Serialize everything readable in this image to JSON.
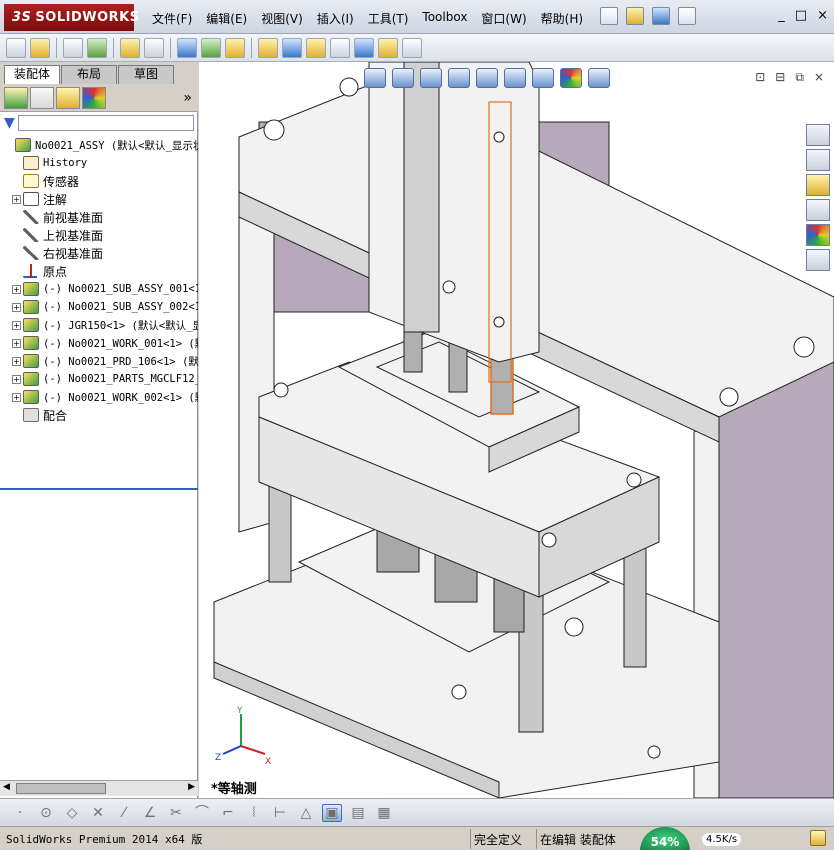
{
  "app": {
    "logo_text": "SOLIDWORKS",
    "logo_prefix": "3S"
  },
  "menu": [
    "文件(F)",
    "编辑(E)",
    "视图(V)",
    "插入(I)",
    "工具(T)",
    "Toolbox",
    "窗口(W)",
    "帮助(H)"
  ],
  "window_controls": [
    "_",
    "□",
    "×"
  ],
  "tabs": [
    {
      "label": "装配体",
      "active": true
    },
    {
      "label": "布局",
      "active": false
    },
    {
      "label": "草图",
      "active": false
    }
  ],
  "feature_manager_more": "»",
  "tree": [
    {
      "label": "No0021_ASSY  (默认<默认_显示状",
      "icon": "assembly-icon",
      "expand": "",
      "indent": 0,
      "mono": true
    },
    {
      "label": "History",
      "icon": "history-icon",
      "expand": "",
      "indent": 1,
      "mono": true
    },
    {
      "label": "传感器",
      "icon": "sensor-icon",
      "expand": "",
      "indent": 1,
      "mono": false
    },
    {
      "label": "注解",
      "icon": "annotation-icon",
      "expand": "+",
      "indent": 1,
      "mono": false
    },
    {
      "label": "前视基准面",
      "icon": "plane-icon",
      "expand": "",
      "indent": 1,
      "mono": false
    },
    {
      "label": "上视基准面",
      "icon": "plane-icon",
      "expand": "",
      "indent": 1,
      "mono": false
    },
    {
      "label": "右视基准面",
      "icon": "plane-icon",
      "expand": "",
      "indent": 1,
      "mono": false
    },
    {
      "label": "原点",
      "icon": "origin-icon",
      "expand": "",
      "indent": 1,
      "mono": false
    },
    {
      "label": "(-) No0021_SUB_ASSY_001<1>",
      "icon": "assembly-icon",
      "expand": "+",
      "indent": 1,
      "mono": true
    },
    {
      "label": "(-) No0021_SUB_ASSY_002<1>",
      "icon": "assembly-icon",
      "expand": "+",
      "indent": 1,
      "mono": true
    },
    {
      "label": "(-) JGR150<1> (默认<默认_显",
      "icon": "assembly-icon",
      "expand": "+",
      "indent": 1,
      "mono": true
    },
    {
      "label": "(-) No0021_WORK_001<1> (默",
      "icon": "part-icon",
      "expand": "+",
      "indent": 1,
      "mono": true
    },
    {
      "label": "(-) No0021_PRD_106<1> (默认",
      "icon": "part-icon",
      "expand": "+",
      "indent": 1,
      "mono": true
    },
    {
      "label": "(-) No0021_PARTS_MGCLF12_",
      "icon": "part-icon",
      "expand": "+",
      "indent": 1,
      "mono": true
    },
    {
      "label": "(-) No0021_WORK_002<1> (默",
      "icon": "part-icon",
      "expand": "+",
      "indent": 1,
      "mono": true
    },
    {
      "label": "配合",
      "icon": "mates-icon",
      "expand": "",
      "indent": 1,
      "mono": false
    }
  ],
  "viewport": {
    "view_name": "*等轴测",
    "window_controls": [
      "⊡",
      "⊟",
      "⧉",
      "×"
    ]
  },
  "triad": {
    "x": "X",
    "y": "Y",
    "z": "Z"
  },
  "status": {
    "product": "SolidWorks Premium 2014 x64 版",
    "definition": "完全定义",
    "editing": "在编辑 装配体",
    "badge": "54%",
    "speed": "4.5K/s"
  },
  "colors": {
    "model_face": "#f2f2f2",
    "model_shade": "#b8a8bc",
    "model_edge": "#202020",
    "highlight": "#e07020",
    "frame_dark": "#a8a8a8"
  }
}
